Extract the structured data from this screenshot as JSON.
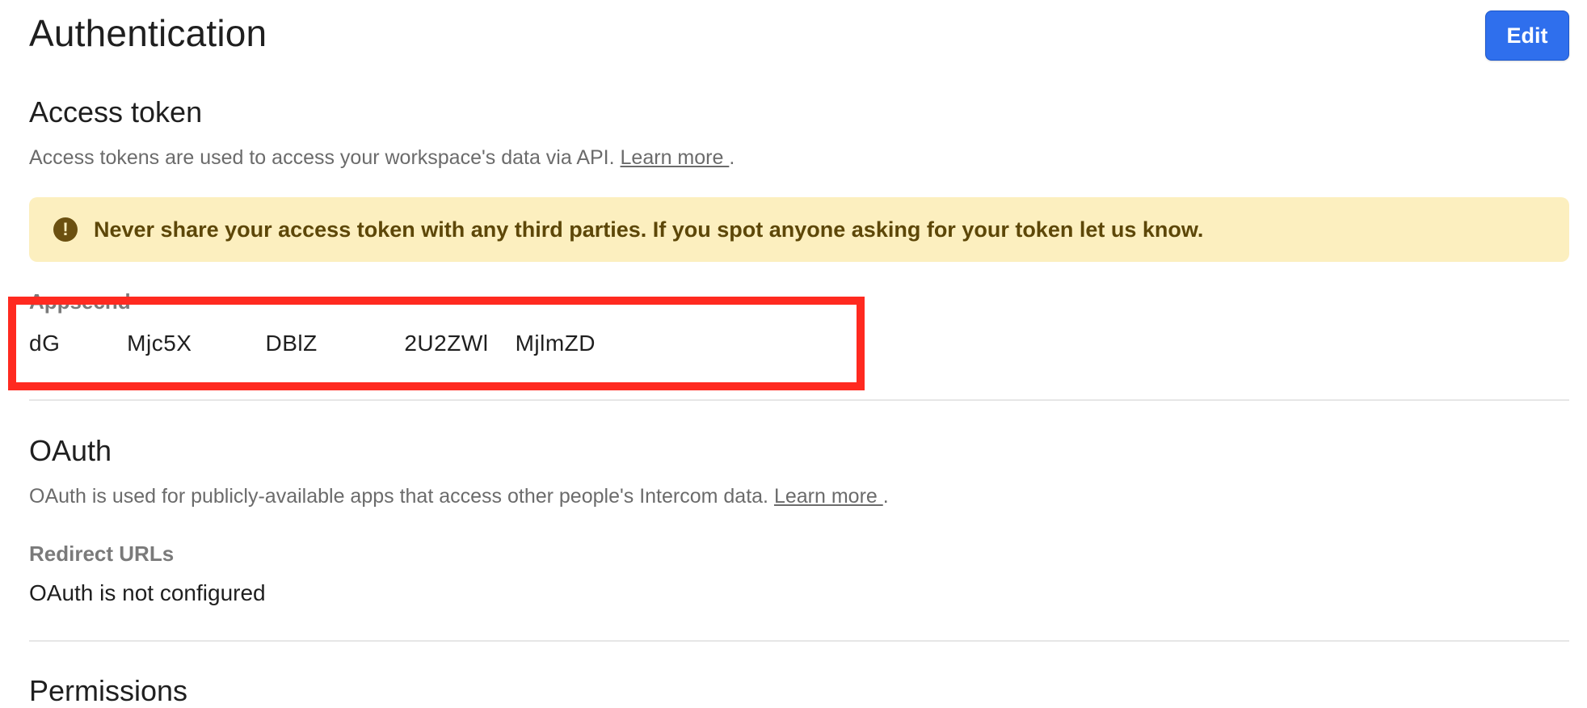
{
  "header": {
    "title": "Authentication",
    "edit_label": "Edit"
  },
  "access_token": {
    "title": "Access token",
    "description": "Access tokens are used to access your workspace's data via API. ",
    "learn_more": "Learn more ",
    "period": ".",
    "warning": "Never share your access token with any third parties. If you spot anyone asking for your token let us know.",
    "warning_icon": "exclamation-circle-icon",
    "field_label": "Appsecnd",
    "token": "dG          Mjc5X           DBlZ             2U2ZWl    MjlmZD    "
  },
  "oauth": {
    "title": "OAuth",
    "description": "OAuth is used for publicly-available apps that access other people's Intercom data. ",
    "learn_more": "Learn more ",
    "period": ".",
    "redirect_label": "Redirect URLs",
    "redirect_value": "OAuth is not configured"
  },
  "permissions": {
    "title": "Permissions"
  },
  "colors": {
    "primary_button": "#2f6fed",
    "warning_bg": "#fcefbf",
    "warning_text": "#5d4708",
    "highlight": "#ff2a20"
  }
}
